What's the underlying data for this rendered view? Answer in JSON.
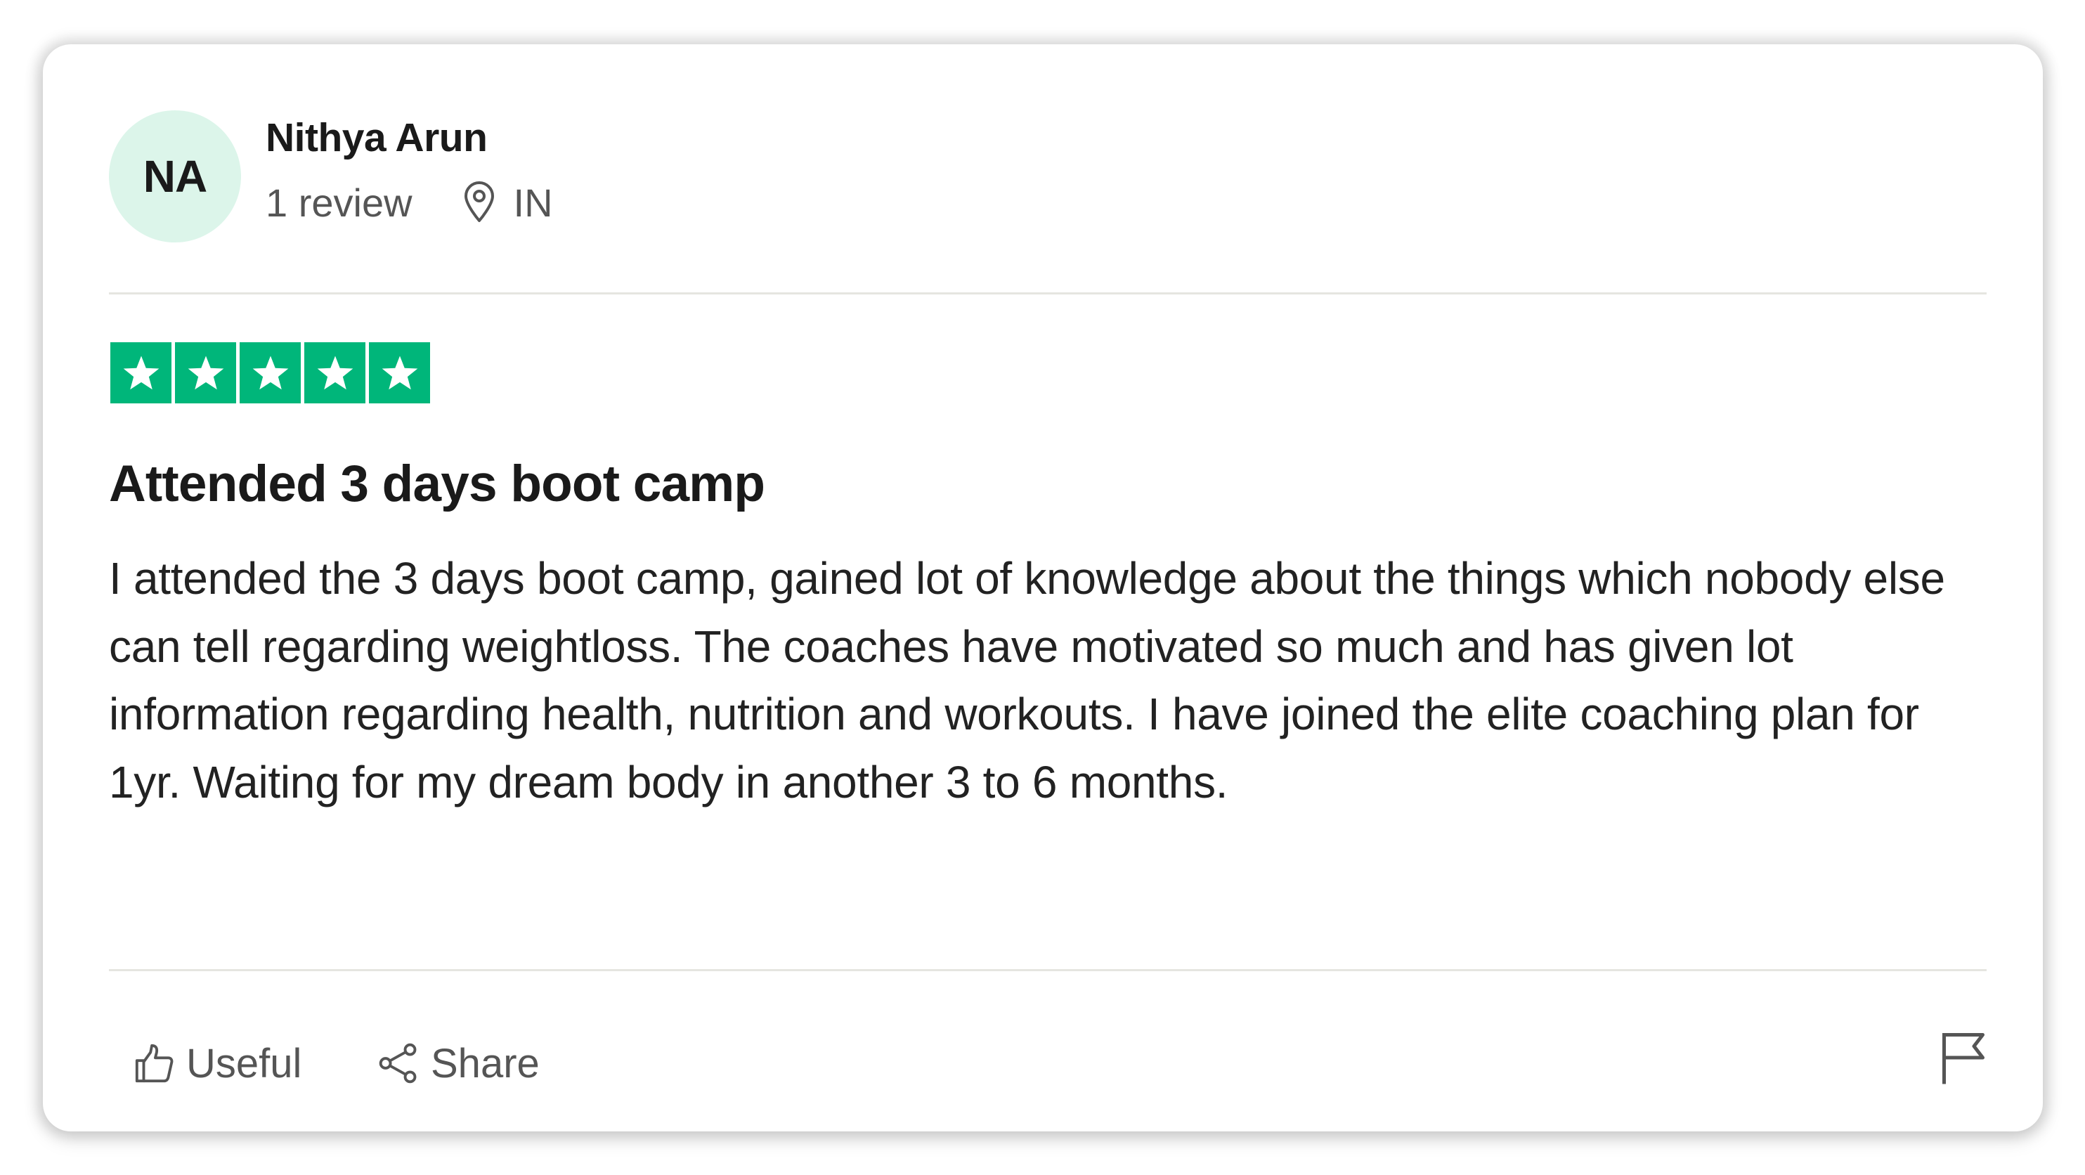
{
  "reviewer": {
    "initials": "NA",
    "name": "Nithya Arun",
    "review_count": "1 review",
    "country": "IN",
    "avatar_color": "#dcf5ea"
  },
  "rating": {
    "stars": 5,
    "max_stars": 5,
    "star_color": "#00b67a"
  },
  "review": {
    "title": "Attended 3 days boot camp",
    "body": "I attended the 3 days boot camp, gained lot of knowledge about the things which nobody else can tell regarding weightloss. The coaches have motivated so much and has given lot information regarding health, nutrition and workouts. I have joined the elite coaching plan for 1yr. Waiting for my dream body in another 3 to 6 months."
  },
  "actions": {
    "useful_label": "Useful",
    "share_label": "Share",
    "useful_icon": "thumbs-up-icon",
    "share_icon": "share-icon",
    "flag_icon": "flag-icon"
  },
  "icons": {
    "location": "location-pin-icon",
    "star": "star-icon"
  }
}
